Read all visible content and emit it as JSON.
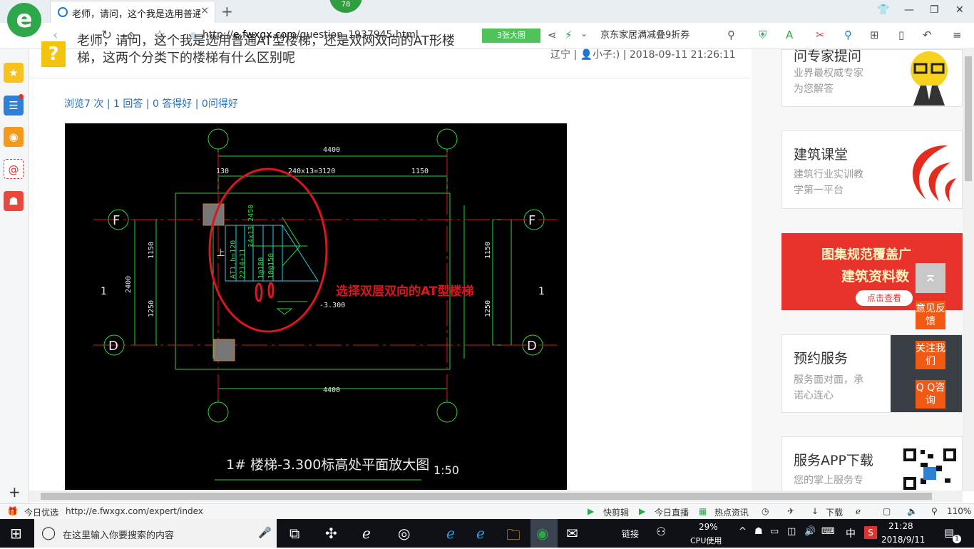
{
  "browser": {
    "badge": "78",
    "tab_title": "老师，请问，这个我是选用普通A",
    "tab_close": "×",
    "new_tab": "+",
    "address": {
      "scheme": "http://",
      "host": "e.fwxgx.com",
      "path": "/question_1937945.html"
    },
    "bigpic_label": "3张大图",
    "search_text": "京东家居满减叠9折券",
    "status_left_label": "今日优选",
    "status_url": "http://e.fwxgx.com/expert/index",
    "status_items": [
      "快剪辑",
      "今日直播",
      "热点资讯",
      "下载",
      "110%"
    ]
  },
  "question": {
    "title_line1": "老师，请问，这个我是选用普通AT型楼梯，还是双网双向的AT形楼",
    "title_line2": "梯，这两个分类下的楼梯有什么区别呢",
    "location": "辽宁",
    "user": "小子:)",
    "datetime": "2018-09-11 21:26:11",
    "stats": "浏览7 次 | 1 回答 | 0 答得好 | 0问得好"
  },
  "cad": {
    "dim_top": "4400",
    "dim_bottom": "4400",
    "dim_a": "130",
    "dim_b": "240x13=3120",
    "dim_c": "1150",
    "axis_F": "F",
    "axis_D": "D",
    "axis_1": "1",
    "dim_left_total": "2400",
    "dim_left_1": "1150",
    "dim_left_2": "1250",
    "dim_right_1": "1150",
    "dim_right_2": "1250",
    "stair_label": "AT1,h=120",
    "stair_txt2": "2214+11",
    "stair_txt3": "14x13 2450",
    "stair_txt4": "1@180",
    "stair_txt5": "10@150",
    "up_label": "上",
    "elev": "-3.300",
    "annotation": "选择双层双向的AT型楼梯",
    "caption": "1# 楼梯-3.300标高处平面放大图",
    "scale": "1:50"
  },
  "sidebar_right": {
    "expert_title": "问专家提问",
    "expert_sub1": "业界最权威专家",
    "expert_sub2": "为您解答",
    "class_title": "建筑课堂",
    "class_sub1": "建筑行业实训教",
    "class_sub2": "学第一平台",
    "banner_line1": "图集规范覆盖广",
    "banner_line2": "建筑资料数",
    "banner_cta": "点击查看",
    "appoint_title": "预约服务",
    "appoint_sub1": "服务面对面，承",
    "appoint_sub2": "诺心连心",
    "app_title": "服务APP下载",
    "app_sub": "您的掌上服务专",
    "float_feedback": "意见反馈",
    "float_follow": "关注我们",
    "float_qq": "Q Q咨询"
  },
  "taskbar": {
    "search_placeholder": "在这里输入你要搜索的内容",
    "link": "链接",
    "cpu_pct": "29%",
    "cpu_label": "CPU使用",
    "ime": "中",
    "time": "21:28",
    "date": "2018/9/11",
    "notif": "1"
  },
  "colors": {
    "accent": "#2ea64a",
    "link": "#2a6db5",
    "cad_green": "#2fd23a",
    "cad_red": "#e0141e",
    "cad_cyan": "#1fd3e6"
  }
}
